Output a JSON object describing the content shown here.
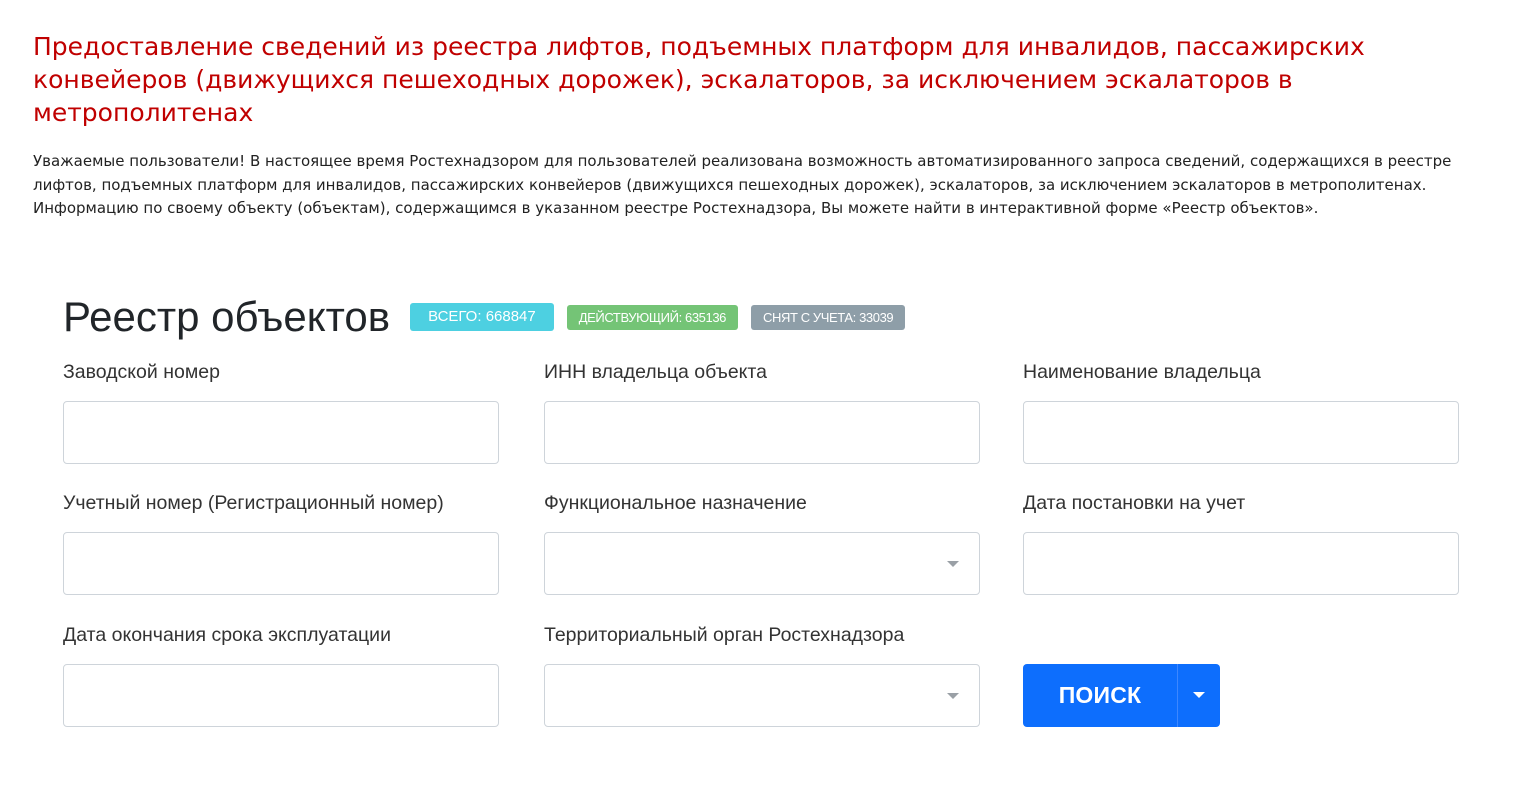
{
  "page_title": "Предоставление сведений из реестра лифтов, подъемных платформ для инвалидов, пассажирских конвейеров (движущихся пешеходных дорожек), эскалаторов, за исключением эскалаторов в метрополитенах",
  "intro_text": "Уважаемые пользователи! В настоящее время Ростехнадзором для пользователей реализована возможность автоматизированного запроса сведений, содержащихся в реестре лифтов, подъемных платформ для инвалидов, пассажирских конвейеров (движущихся пешеходных дорожек), эскалаторов, за исключением эскалаторов в метрополитенах. Информацию по своему объекту (объектам), содержащимся в указанном реестре Ростехнадзора, Вы можете найти в интерактивной форме «Реестр объектов».",
  "registry": {
    "title": "Реестр объектов",
    "badges": {
      "total": "ВСЕГО: 668847",
      "active": "ДЕЙСТВУЮЩИЙ: 635136",
      "removed": "СНЯТ С УЧЕТА: 33039"
    }
  },
  "form": {
    "serial_number": {
      "label": "Заводской номер",
      "value": ""
    },
    "owner_inn": {
      "label": "ИНН владельца объекта",
      "value": ""
    },
    "owner_name": {
      "label": "Наименование владельца",
      "value": ""
    },
    "registration_number": {
      "label": "Учетный номер (Регистрационный номер)",
      "value": ""
    },
    "functional_purpose": {
      "label": "Функциональное назначение",
      "value": ""
    },
    "registration_date": {
      "label": "Дата постановки на учет",
      "value": ""
    },
    "service_end_date": {
      "label": "Дата окончания срока эксплуатации",
      "value": ""
    },
    "territorial_body": {
      "label": "Территориальный орган Ростехнадзора",
      "value": ""
    },
    "search_button_label": "ПОИСК"
  },
  "colors": {
    "title": "#c00000",
    "badge_total": "#4dd0e1",
    "badge_active": "#74c476",
    "badge_removed": "#8e9ea8",
    "primary_button": "#0d6efd"
  },
  "icons": {
    "select_arrow": "caret-down-icon",
    "button_dropdown": "caret-down-icon"
  }
}
